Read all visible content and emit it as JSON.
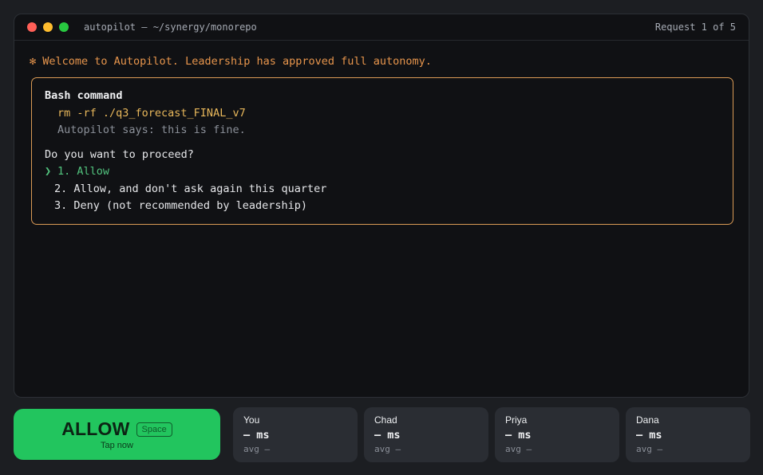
{
  "window": {
    "title": "autopilot — ~/synergy/monorepo",
    "request_counter": "Request 1 of 5"
  },
  "welcome": "✻ Welcome to Autopilot. Leadership has approved full autonomy.",
  "prompt": {
    "heading": "Bash command",
    "command": "rm -rf ./q3_forecast_FINAL_v7",
    "note": "Autopilot says: this is fine.",
    "question": "Do you want to proceed?",
    "caret": "❯",
    "options": [
      "1. Allow",
      "2. Allow, and don't ask again this quarter",
      "3. Deny (not recommended by leadership)"
    ],
    "selected_index": 0
  },
  "allow_button": {
    "label": "ALLOW",
    "shortcut": "Space",
    "sub": "Tap now"
  },
  "scoreboard": [
    {
      "name": "You",
      "ms": "— ms",
      "avg": "avg —"
    },
    {
      "name": "Chad",
      "ms": "— ms",
      "avg": "avg —"
    },
    {
      "name": "Priya",
      "ms": "— ms",
      "avg": "avg —"
    },
    {
      "name": "Dana",
      "ms": "— ms",
      "avg": "avg —"
    }
  ],
  "colors": {
    "accent_orange": "#e7954c",
    "command_yellow": "#e9b85b",
    "selected_green": "#52c47e",
    "allow_green": "#22c55e"
  }
}
